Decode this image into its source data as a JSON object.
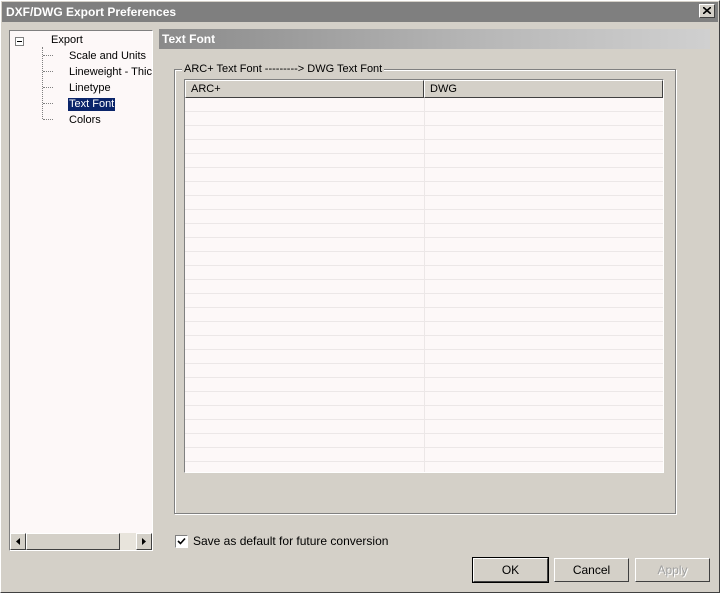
{
  "window": {
    "title": "DXF/DWG Export Preferences"
  },
  "tree": {
    "root": "Export",
    "items": [
      {
        "label": "Scale and Units",
        "selected": false
      },
      {
        "label": "Lineweight - Thickness",
        "selected": false
      },
      {
        "label": "Linetype",
        "selected": false
      },
      {
        "label": "Text Font",
        "selected": true
      },
      {
        "label": "Colors",
        "selected": false
      }
    ]
  },
  "panel": {
    "title": "Text Font",
    "group_label": "ARC+ Text Font ---------> DWG Text Font",
    "columns": [
      "ARC+",
      "DWG"
    ],
    "rows": []
  },
  "options": {
    "save_default_label": "Save as default for future conversion",
    "save_default_checked": true
  },
  "buttons": {
    "ok": "OK",
    "cancel": "Cancel",
    "apply": "Apply"
  }
}
